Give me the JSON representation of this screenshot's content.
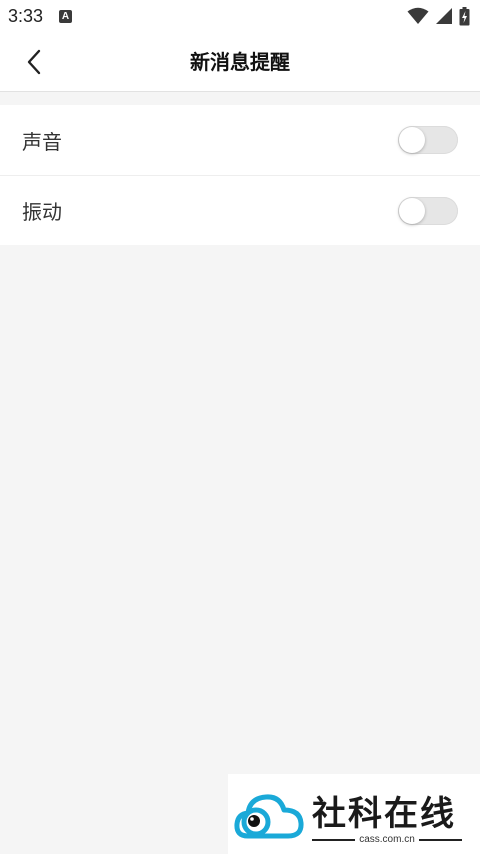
{
  "status_bar": {
    "time": "3:33",
    "notification_icon": "a-icon",
    "wifi_icon": "wifi-icon",
    "signal_icon": "signal-icon",
    "battery_icon": "battery-charging-icon"
  },
  "app_bar": {
    "title": "新消息提醒",
    "back_icon": "chevron-left-icon"
  },
  "settings": {
    "items": [
      {
        "label": "声音",
        "enabled": false
      },
      {
        "label": "振动",
        "enabled": false
      }
    ]
  },
  "watermark": {
    "title": "社科在线",
    "url": "cass.com.cn"
  },
  "colors": {
    "background": "#f5f5f5",
    "surface": "#ffffff",
    "toggle_off": "#e6e6e6",
    "logo_blue": "#1aa9d8"
  }
}
